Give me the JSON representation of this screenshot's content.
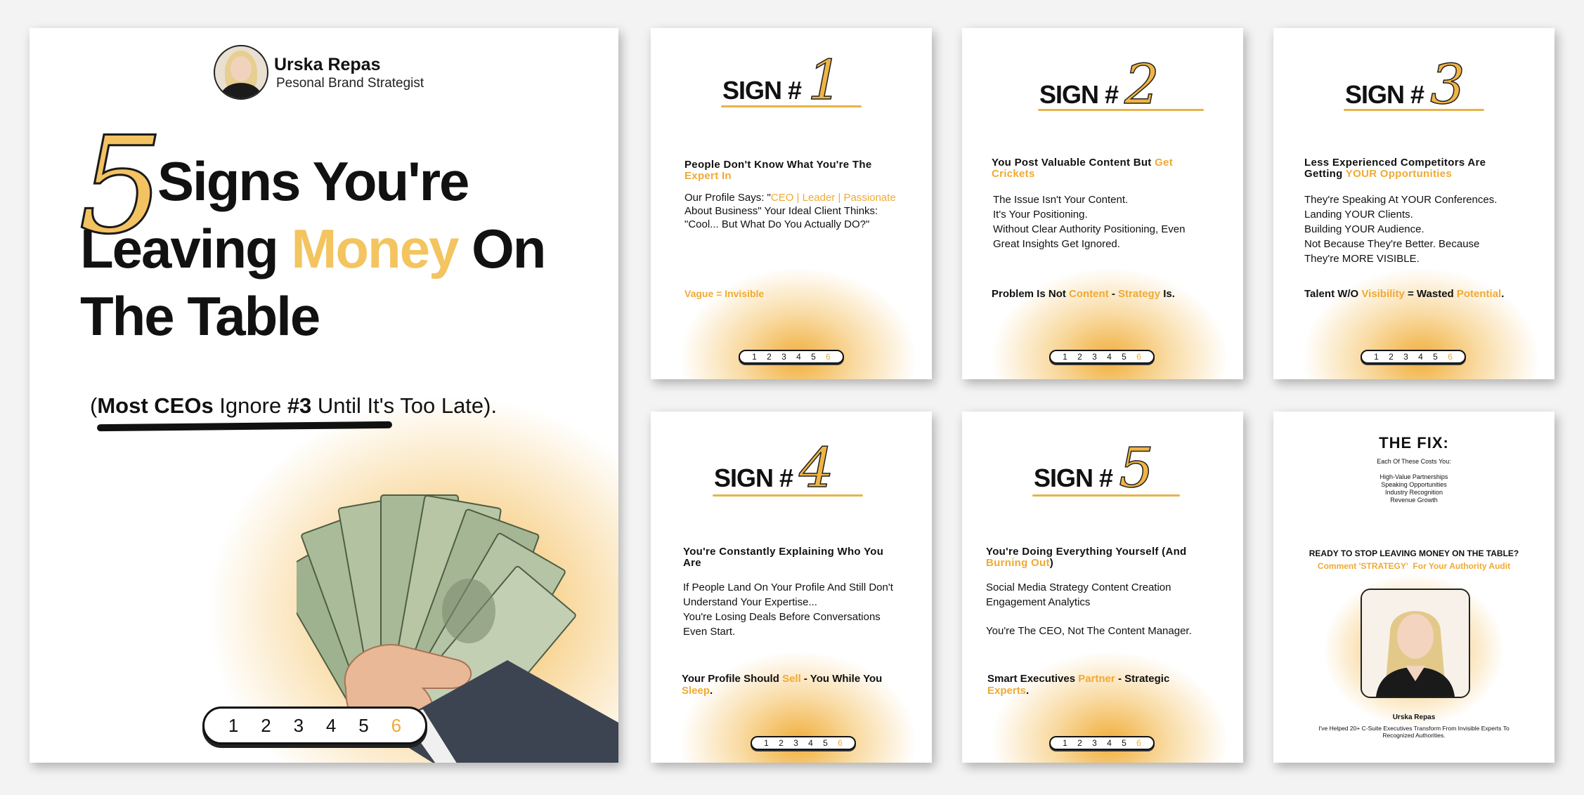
{
  "cover": {
    "name": "Urska Repas",
    "role": "Pesonal Brand Strategist",
    "big_number": "5",
    "line1": "Signs You're",
    "line2_a": "Leaving ",
    "line2_money": "Money",
    "line2_b": " On",
    "line3": "The Table",
    "sub_open": "(",
    "sub_most": "Most CEOs",
    "sub_ignore": " Ignore ",
    "sub_three": "#3",
    "sub_rest": " Until It's Too Late).",
    "pages": [
      "1",
      "2",
      "3",
      "4",
      "5",
      "6"
    ]
  },
  "sign_label": "SIGN #",
  "cards": {
    "s1": {
      "num": "1",
      "title_a": "People Don't Know What You're The ",
      "title_b": "Expert In",
      "body_a": "Our Profile Says: \"",
      "body_gold": "CEO | Leader | Passionate",
      "body_b": " About Business\" Your Ideal Client Thinks: \"Cool... But What Do You Actually DO?\"",
      "foot": "Vague = Invisible"
    },
    "s2": {
      "num": "2",
      "title_a": "You Post Valuable Content But ",
      "title_b": "Get Crickets",
      "body1": "The Issue Isn't Your Content.",
      "body2": "It's Your Positioning.",
      "body3": "Without Clear Authority Positioning, Even Great Insights Get Ignored.",
      "foot_a": "Problem Is Not ",
      "foot_b": "Content",
      "foot_c": " - ",
      "foot_d": "Strategy",
      "foot_e": " Is."
    },
    "s3": {
      "num": "3",
      "title_a": "Less Experienced Competitors Are Getting ",
      "title_b": "YOUR Opportunities",
      "body1": "They're Speaking At YOUR Conferences.",
      "body2": "Landing YOUR Clients.",
      "body3": "Building YOUR Audience.",
      "body4": "Not Because They're Better. Because They're MORE VISIBLE.",
      "foot_a": "Talent W/O ",
      "foot_b": "Visibility",
      "foot_c": " = Wasted ",
      "foot_d": "Potential",
      "foot_e": "."
    },
    "s4": {
      "num": "4",
      "title": "You're Constantly Explaining Who You Are",
      "body1": "If People Land On Your Profile And Still Don't Understand Your Expertise...",
      "body2": "You're Losing Deals Before Conversations Even Start.",
      "foot_a": "Your Profile Should ",
      "foot_b": "Sell",
      "foot_c": " - You While You ",
      "foot_d": "Sleep",
      "foot_e": "."
    },
    "s5": {
      "num": "5",
      "title_a": "You're Doing Everything Yourself (And ",
      "title_b": "Burning Out",
      "title_c": ")",
      "body1": "Social Media Strategy Content Creation Engagement Analytics",
      "body2": "You're The CEO, Not The Content Manager.",
      "foot_a": "Smart Executives ",
      "foot_b": "Partner",
      "foot_c": " - Strategic ",
      "foot_d": "Experts",
      "foot_e": "."
    },
    "fix": {
      "title": "THE FIX:",
      "costs": "Each Of These Costs You:",
      "items": [
        "High-Value Partnerships",
        "Speaking Opportunities",
        "Industry Recognition",
        "Revenue Growth"
      ],
      "ready": "READY TO STOP LEAVING MONEY ON THE TABLE?",
      "cta_a": "Comment 'STRATEGY'",
      "cta_b": "  For Your Authority Audit",
      "name": "Urska Repas",
      "bio": "I've Helped 20+ C-Suite Executives Transform From Invisible Experts To Recognized Authorities."
    }
  },
  "colors": {
    "gold": "#efaa35",
    "ink": "#111111"
  }
}
